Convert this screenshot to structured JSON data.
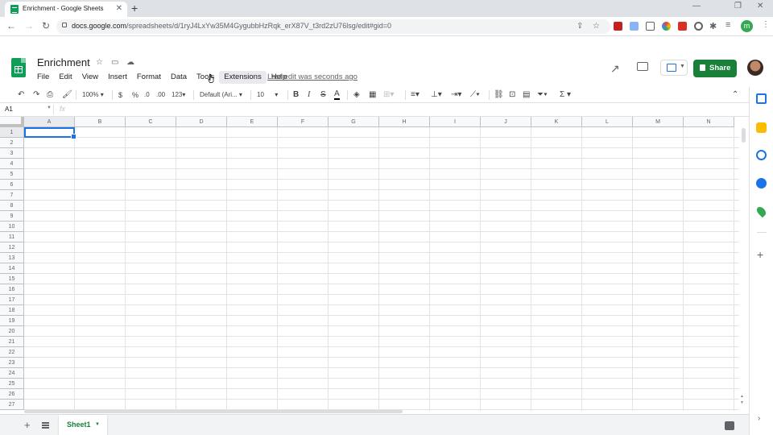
{
  "browser": {
    "tab_title": "Enrichment - Google Sheets",
    "tab_close": "✕",
    "new_tab": "+",
    "window_controls": [
      "—",
      "❐",
      "✕"
    ],
    "nav": {
      "back": "←",
      "forward": "→",
      "reload": "↻"
    },
    "url_host": "docs.google.com",
    "url_path": "/spreadsheets/d/1ryJ4LxYw35M4GygubbHzRqk_erX87V_t3rd2zU76lsg/edit#gid=0",
    "profile_initial": "m",
    "extension_colors": [
      "#c5221f",
      "#1a73e8",
      "#5f6368",
      "#a142f4",
      "#d93025",
      "#5f6368",
      "#5f6368",
      "#5f6368"
    ]
  },
  "doc": {
    "title": "Enrichment",
    "menus": [
      "File",
      "Edit",
      "View",
      "Insert",
      "Format",
      "Data",
      "Tools",
      "Extensions",
      "Help"
    ],
    "active_menu": "Extensions",
    "last_edit": "Last edit was seconds ago",
    "share_label": "Share",
    "accent_color": "#188038"
  },
  "toolbar": {
    "zoom": "100%",
    "currency": "$",
    "percent": "%",
    "dec_decrease": ".0",
    "dec_increase": ".00",
    "more_formats": "123",
    "font": "Default (Ari...",
    "font_size": "10",
    "bold": "B",
    "italic": "I",
    "strike": "S",
    "text_color": "A",
    "sigma": "Σ"
  },
  "formula_bar": {
    "name_box": "A1",
    "fx": "fx"
  },
  "grid": {
    "columns": [
      "A",
      "B",
      "C",
      "D",
      "E",
      "F",
      "G",
      "H",
      "I",
      "J",
      "K",
      "L",
      "M",
      "N"
    ],
    "rows": [
      "1",
      "2",
      "3",
      "4",
      "5",
      "6",
      "7",
      "8",
      "9",
      "10",
      "11",
      "12",
      "13",
      "14",
      "15",
      "16",
      "17",
      "18",
      "19",
      "20",
      "21",
      "22",
      "23",
      "24",
      "25",
      "26",
      "27"
    ],
    "selected_cell": "A1"
  },
  "sheets": {
    "add": "+",
    "active_sheet": "Sheet1"
  }
}
